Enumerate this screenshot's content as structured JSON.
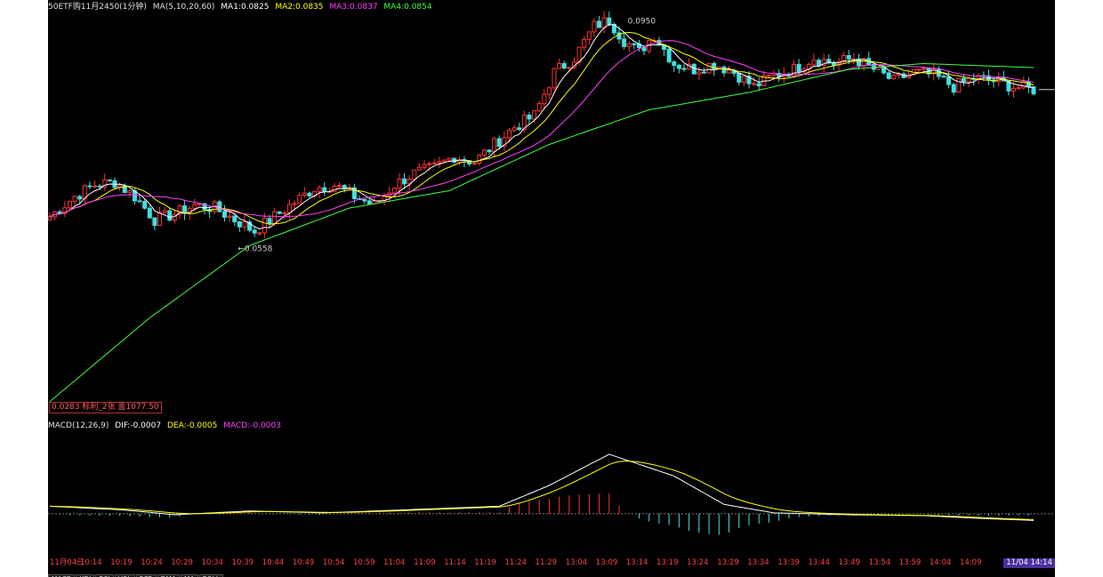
{
  "header": {
    "instrument": "50ETF购11月2450(1分钟)",
    "ma_label": "MA(5,10,20,60)",
    "ma_values": [
      {
        "label": "MA1:0.0825",
        "color": "#ffffff"
      },
      {
        "label": "MA2:0.0835",
        "color": "#ffff00"
      },
      {
        "label": "MA3:0.0837",
        "color": "#ff40ff"
      },
      {
        "label": "MA4:0.0854",
        "color": "#40ff40"
      }
    ]
  },
  "macd_header": {
    "label": "MACD(12,26,9)",
    "dif": "DIF:-0.0007",
    "dea": "DEA:-0.0005",
    "macd": "MACD:-0.0003"
  },
  "info_tag": "0.0283 标利_2张 盈1077.50",
  "tabs": [
    "MACD",
    "KDJ",
    "RSI",
    "VOL",
    "PCR",
    "DMA",
    "MA",
    "BOLL"
  ],
  "current_time": "11/04 14:14",
  "colors": {
    "up": "#ff3232",
    "down": "#40e0e0",
    "ma1": "#ffffff",
    "ma2": "#ffff00",
    "ma3": "#ff40ff",
    "ma4": "#40ff40"
  },
  "chart_data": {
    "type": "candlestick",
    "price_range": [
      0.028,
      0.096
    ],
    "macd_range": [
      -0.0033,
      0.0078
    ],
    "annotations": [
      {
        "text": "0.0950",
        "time": "13:10",
        "value": 0.095,
        "role": "high"
      },
      {
        "text": "←0.0558",
        "time": "10:34",
        "value": 0.0558,
        "role": "low"
      }
    ],
    "time_ticks": [
      "11月04日",
      "10:14",
      "10:19",
      "10:24",
      "10:29",
      "10:34",
      "10:39",
      "10:44",
      "10:49",
      "10:54",
      "10:59",
      "11:04",
      "11:09",
      "11:14",
      "11:19",
      "11:24",
      "11:29",
      "13:04",
      "13:09",
      "13:14",
      "13:19",
      "13:24",
      "13:29",
      "13:34",
      "13:39",
      "13:44",
      "13:49",
      "13:54",
      "13:59",
      "14:04",
      "14:09"
    ],
    "close_path": [
      [
        0,
        0.0605
      ],
      [
        5,
        0.064
      ],
      [
        9,
        0.066
      ],
      [
        13,
        0.0665
      ],
      [
        17,
        0.064
      ],
      [
        21,
        0.06
      ],
      [
        25,
        0.061
      ],
      [
        29,
        0.0625
      ],
      [
        33,
        0.062
      ],
      [
        37,
        0.06
      ],
      [
        41,
        0.058
      ],
      [
        45,
        0.0605
      ],
      [
        49,
        0.063
      ],
      [
        53,
        0.0655
      ],
      [
        57,
        0.066
      ],
      [
        61,
        0.064
      ],
      [
        65,
        0.0625
      ],
      [
        69,
        0.066
      ],
      [
        73,
        0.068
      ],
      [
        77,
        0.069
      ],
      [
        81,
        0.071
      ],
      [
        85,
        0.07
      ],
      [
        89,
        0.073
      ],
      [
        93,
        0.076
      ],
      [
        97,
        0.078
      ],
      [
        101,
        0.0855
      ],
      [
        105,
        0.088
      ],
      [
        109,
        0.0935
      ],
      [
        112,
        0.0945
      ],
      [
        115,
        0.091
      ],
      [
        118,
        0.089
      ],
      [
        121,
        0.092
      ],
      [
        125,
        0.087
      ],
      [
        129,
        0.086
      ],
      [
        133,
        0.087
      ],
      [
        137,
        0.0855
      ],
      [
        141,
        0.083
      ],
      [
        145,
        0.085
      ],
      [
        149,
        0.086
      ],
      [
        153,
        0.088
      ],
      [
        157,
        0.087
      ],
      [
        161,
        0.088
      ],
      [
        165,
        0.086
      ],
      [
        169,
        0.084
      ],
      [
        173,
        0.0855
      ],
      [
        177,
        0.085
      ],
      [
        181,
        0.083
      ],
      [
        185,
        0.0845
      ],
      [
        189,
        0.084
      ],
      [
        193,
        0.083
      ],
      [
        197,
        0.0825
      ]
    ],
    "ma4_path": [
      [
        0,
        0.0285
      ],
      [
        20,
        0.043
      ],
      [
        40,
        0.0555
      ],
      [
        60,
        0.062
      ],
      [
        80,
        0.065
      ],
      [
        100,
        0.073
      ],
      [
        120,
        0.079
      ],
      [
        140,
        0.082
      ],
      [
        160,
        0.086
      ],
      [
        175,
        0.087
      ],
      [
        197,
        0.0863
      ]
    ],
    "macd_dif_path": [
      [
        0,
        0.0008
      ],
      [
        15,
        0.0004
      ],
      [
        25,
        -0.0001
      ],
      [
        40,
        0.0003
      ],
      [
        55,
        0.0001
      ],
      [
        70,
        0.0004
      ],
      [
        90,
        0.0008
      ],
      [
        100,
        0.003
      ],
      [
        112,
        0.0063
      ],
      [
        125,
        0.004
      ],
      [
        135,
        0.001
      ],
      [
        145,
        0.0001
      ],
      [
        160,
        -0.0001
      ],
      [
        175,
        -0.0002
      ],
      [
        187,
        -0.0005
      ],
      [
        197,
        -0.0007
      ]
    ]
  }
}
